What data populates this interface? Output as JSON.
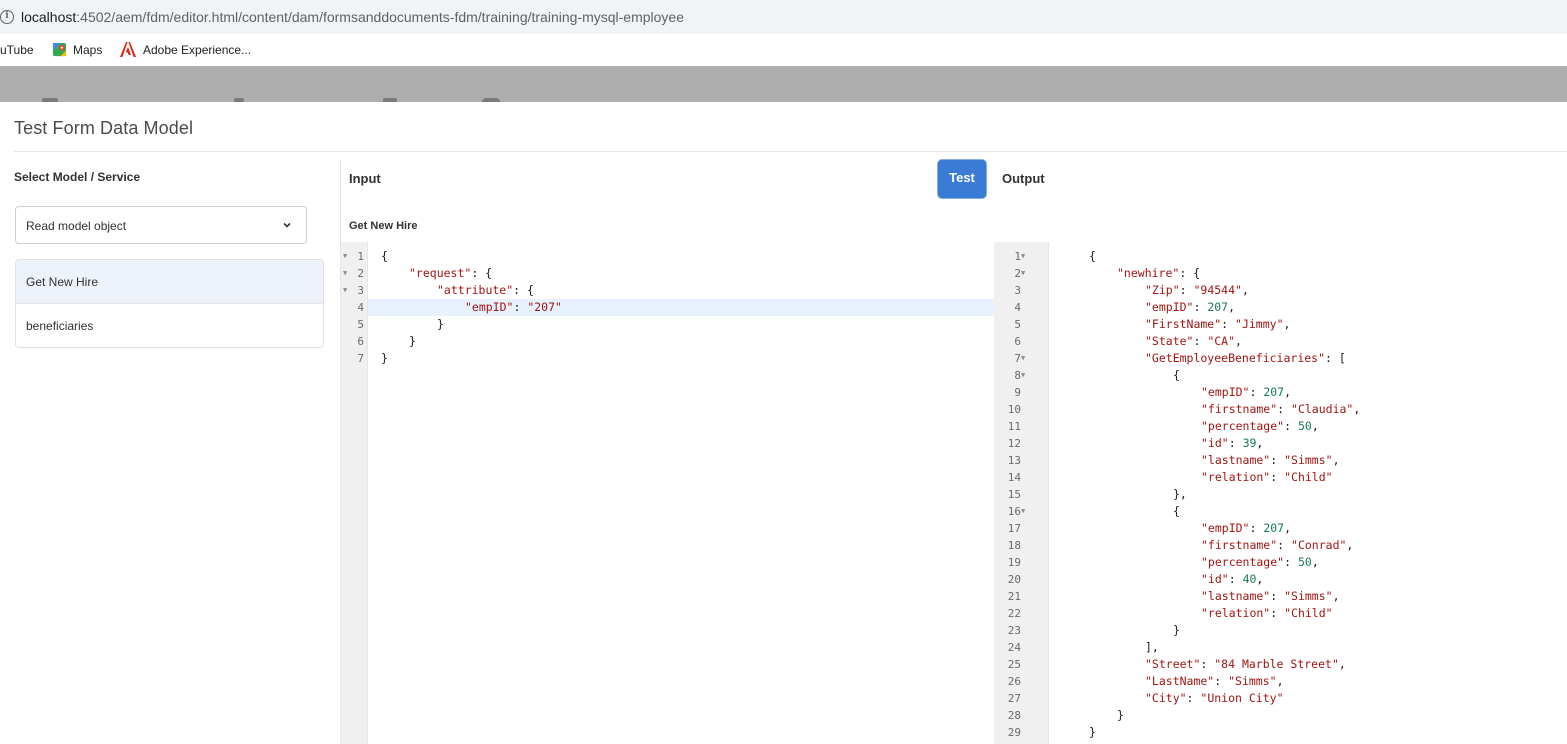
{
  "browser": {
    "url_host": "localhost",
    "url_rest": ":4502/aem/fdm/editor.html/content/dam/formsanddocuments-fdm/training/training-mysql-employee",
    "bookmarks": [
      {
        "label": "uTube"
      },
      {
        "label": "Maps"
      },
      {
        "label": "Adobe Experience..."
      }
    ]
  },
  "dialog": {
    "title": "Test Form Data Model",
    "select_heading": "Select Model / Service",
    "select_value": "Read model object",
    "services": [
      {
        "label": "Get New Hire",
        "active": true
      },
      {
        "label": "beneficiaries",
        "active": false
      }
    ],
    "input_heading": "Input",
    "test_label": "Test",
    "output_heading": "Output",
    "service_name": "Get New Hire"
  },
  "input_lines": [
    {
      "n": "1",
      "fold": true,
      "indent": 0,
      "tokens": [
        [
          "p",
          "{"
        ]
      ]
    },
    {
      "n": "2",
      "fold": true,
      "indent": 1,
      "tokens": [
        [
          "k",
          "\"request\""
        ],
        [
          "p",
          ": {"
        ]
      ]
    },
    {
      "n": "3",
      "fold": true,
      "indent": 2,
      "tokens": [
        [
          "k",
          "\"attribute\""
        ],
        [
          "p",
          ": {"
        ]
      ]
    },
    {
      "n": "4",
      "fold": false,
      "indent": 3,
      "active": true,
      "tokens": [
        [
          "k",
          "\"empID\""
        ],
        [
          "p",
          ": "
        ],
        [
          "s",
          "\"207\""
        ]
      ]
    },
    {
      "n": "5",
      "fold": false,
      "indent": 2,
      "tokens": [
        [
          "p",
          "}"
        ]
      ]
    },
    {
      "n": "6",
      "fold": false,
      "indent": 1,
      "tokens": [
        [
          "p",
          "}"
        ]
      ]
    },
    {
      "n": "7",
      "fold": false,
      "indent": 0,
      "tokens": [
        [
          "p",
          "}"
        ]
      ]
    }
  ],
  "output_lines": [
    {
      "n": "1",
      "fold": true,
      "indent": 0,
      "tokens": [
        [
          "p",
          "{"
        ]
      ]
    },
    {
      "n": "2",
      "fold": true,
      "indent": 1,
      "tokens": [
        [
          "k",
          "\"newhire\""
        ],
        [
          "p",
          ": {"
        ]
      ]
    },
    {
      "n": "3",
      "fold": false,
      "indent": 2,
      "tokens": [
        [
          "k",
          "\"Zip\""
        ],
        [
          "p",
          ": "
        ],
        [
          "s",
          "\"94544\""
        ],
        [
          "p",
          ","
        ]
      ]
    },
    {
      "n": "4",
      "fold": false,
      "indent": 2,
      "tokens": [
        [
          "k",
          "\"empID\""
        ],
        [
          "p",
          ": "
        ],
        [
          "n",
          "207"
        ],
        [
          "p",
          ","
        ]
      ]
    },
    {
      "n": "5",
      "fold": false,
      "indent": 2,
      "tokens": [
        [
          "k",
          "\"FirstName\""
        ],
        [
          "p",
          ": "
        ],
        [
          "s",
          "\"Jimmy\""
        ],
        [
          "p",
          ","
        ]
      ]
    },
    {
      "n": "6",
      "fold": false,
      "indent": 2,
      "tokens": [
        [
          "k",
          "\"State\""
        ],
        [
          "p",
          ": "
        ],
        [
          "s",
          "\"CA\""
        ],
        [
          "p",
          ","
        ]
      ]
    },
    {
      "n": "7",
      "fold": true,
      "indent": 2,
      "tokens": [
        [
          "k",
          "\"GetEmployeeBeneficiaries\""
        ],
        [
          "p",
          ": ["
        ]
      ]
    },
    {
      "n": "8",
      "fold": true,
      "indent": 3,
      "tokens": [
        [
          "p",
          "{"
        ]
      ]
    },
    {
      "n": "9",
      "fold": false,
      "indent": 4,
      "tokens": [
        [
          "k",
          "\"empID\""
        ],
        [
          "p",
          ": "
        ],
        [
          "n",
          "207"
        ],
        [
          "p",
          ","
        ]
      ]
    },
    {
      "n": "10",
      "fold": false,
      "indent": 4,
      "tokens": [
        [
          "k",
          "\"firstname\""
        ],
        [
          "p",
          ": "
        ],
        [
          "s",
          "\"Claudia\""
        ],
        [
          "p",
          ","
        ]
      ]
    },
    {
      "n": "11",
      "fold": false,
      "indent": 4,
      "tokens": [
        [
          "k",
          "\"percentage\""
        ],
        [
          "p",
          ": "
        ],
        [
          "n",
          "50"
        ],
        [
          "p",
          ","
        ]
      ]
    },
    {
      "n": "12",
      "fold": false,
      "indent": 4,
      "tokens": [
        [
          "k",
          "\"id\""
        ],
        [
          "p",
          ": "
        ],
        [
          "n",
          "39"
        ],
        [
          "p",
          ","
        ]
      ]
    },
    {
      "n": "13",
      "fold": false,
      "indent": 4,
      "tokens": [
        [
          "k",
          "\"lastname\""
        ],
        [
          "p",
          ": "
        ],
        [
          "s",
          "\"Simms\""
        ],
        [
          "p",
          ","
        ]
      ]
    },
    {
      "n": "14",
      "fold": false,
      "indent": 4,
      "tokens": [
        [
          "k",
          "\"relation\""
        ],
        [
          "p",
          ": "
        ],
        [
          "s",
          "\"Child\""
        ]
      ]
    },
    {
      "n": "15",
      "fold": false,
      "indent": 3,
      "tokens": [
        [
          "p",
          "},"
        ]
      ]
    },
    {
      "n": "16",
      "fold": true,
      "indent": 3,
      "tokens": [
        [
          "p",
          "{"
        ]
      ]
    },
    {
      "n": "17",
      "fold": false,
      "indent": 4,
      "tokens": [
        [
          "k",
          "\"empID\""
        ],
        [
          "p",
          ": "
        ],
        [
          "n",
          "207"
        ],
        [
          "p",
          ","
        ]
      ]
    },
    {
      "n": "18",
      "fold": false,
      "indent": 4,
      "tokens": [
        [
          "k",
          "\"firstname\""
        ],
        [
          "p",
          ": "
        ],
        [
          "s",
          "\"Conrad\""
        ],
        [
          "p",
          ","
        ]
      ]
    },
    {
      "n": "19",
      "fold": false,
      "indent": 4,
      "tokens": [
        [
          "k",
          "\"percentage\""
        ],
        [
          "p",
          ": "
        ],
        [
          "n",
          "50"
        ],
        [
          "p",
          ","
        ]
      ]
    },
    {
      "n": "20",
      "fold": false,
      "indent": 4,
      "tokens": [
        [
          "k",
          "\"id\""
        ],
        [
          "p",
          ": "
        ],
        [
          "n",
          "40"
        ],
        [
          "p",
          ","
        ]
      ]
    },
    {
      "n": "21",
      "fold": false,
      "indent": 4,
      "tokens": [
        [
          "k",
          "\"lastname\""
        ],
        [
          "p",
          ": "
        ],
        [
          "s",
          "\"Simms\""
        ],
        [
          "p",
          ","
        ]
      ]
    },
    {
      "n": "22",
      "fold": false,
      "indent": 4,
      "tokens": [
        [
          "k",
          "\"relation\""
        ],
        [
          "p",
          ": "
        ],
        [
          "s",
          "\"Child\""
        ]
      ]
    },
    {
      "n": "23",
      "fold": false,
      "indent": 3,
      "tokens": [
        [
          "p",
          "}"
        ]
      ]
    },
    {
      "n": "24",
      "fold": false,
      "indent": 2,
      "tokens": [
        [
          "p",
          "],"
        ]
      ]
    },
    {
      "n": "25",
      "fold": false,
      "indent": 2,
      "tokens": [
        [
          "k",
          "\"Street\""
        ],
        [
          "p",
          ": "
        ],
        [
          "s",
          "\"84 Marble Street\""
        ],
        [
          "p",
          ","
        ]
      ]
    },
    {
      "n": "26",
      "fold": false,
      "indent": 2,
      "tokens": [
        [
          "k",
          "\"LastName\""
        ],
        [
          "p",
          ": "
        ],
        [
          "s",
          "\"Simms\""
        ],
        [
          "p",
          ","
        ]
      ]
    },
    {
      "n": "27",
      "fold": false,
      "indent": 2,
      "tokens": [
        [
          "k",
          "\"City\""
        ],
        [
          "p",
          ": "
        ],
        [
          "s",
          "\"Union City\""
        ]
      ]
    },
    {
      "n": "28",
      "fold": false,
      "indent": 1,
      "tokens": [
        [
          "p",
          "}"
        ]
      ]
    },
    {
      "n": "29",
      "fold": false,
      "indent": 0,
      "tokens": [
        [
          "p",
          "}"
        ]
      ]
    }
  ],
  "icons": {
    "info": "info-icon",
    "maps": "maps-icon",
    "adobe": "adobe-icon",
    "chevron": "chevron-down-icon",
    "fold": "fold-arrow-icon"
  },
  "colors": {
    "accent": "#3a7bd5",
    "selected_row": "#eef3fb",
    "active_line": "#e8f2ff",
    "string": "#a31515",
    "number": "#1c7a5a"
  }
}
